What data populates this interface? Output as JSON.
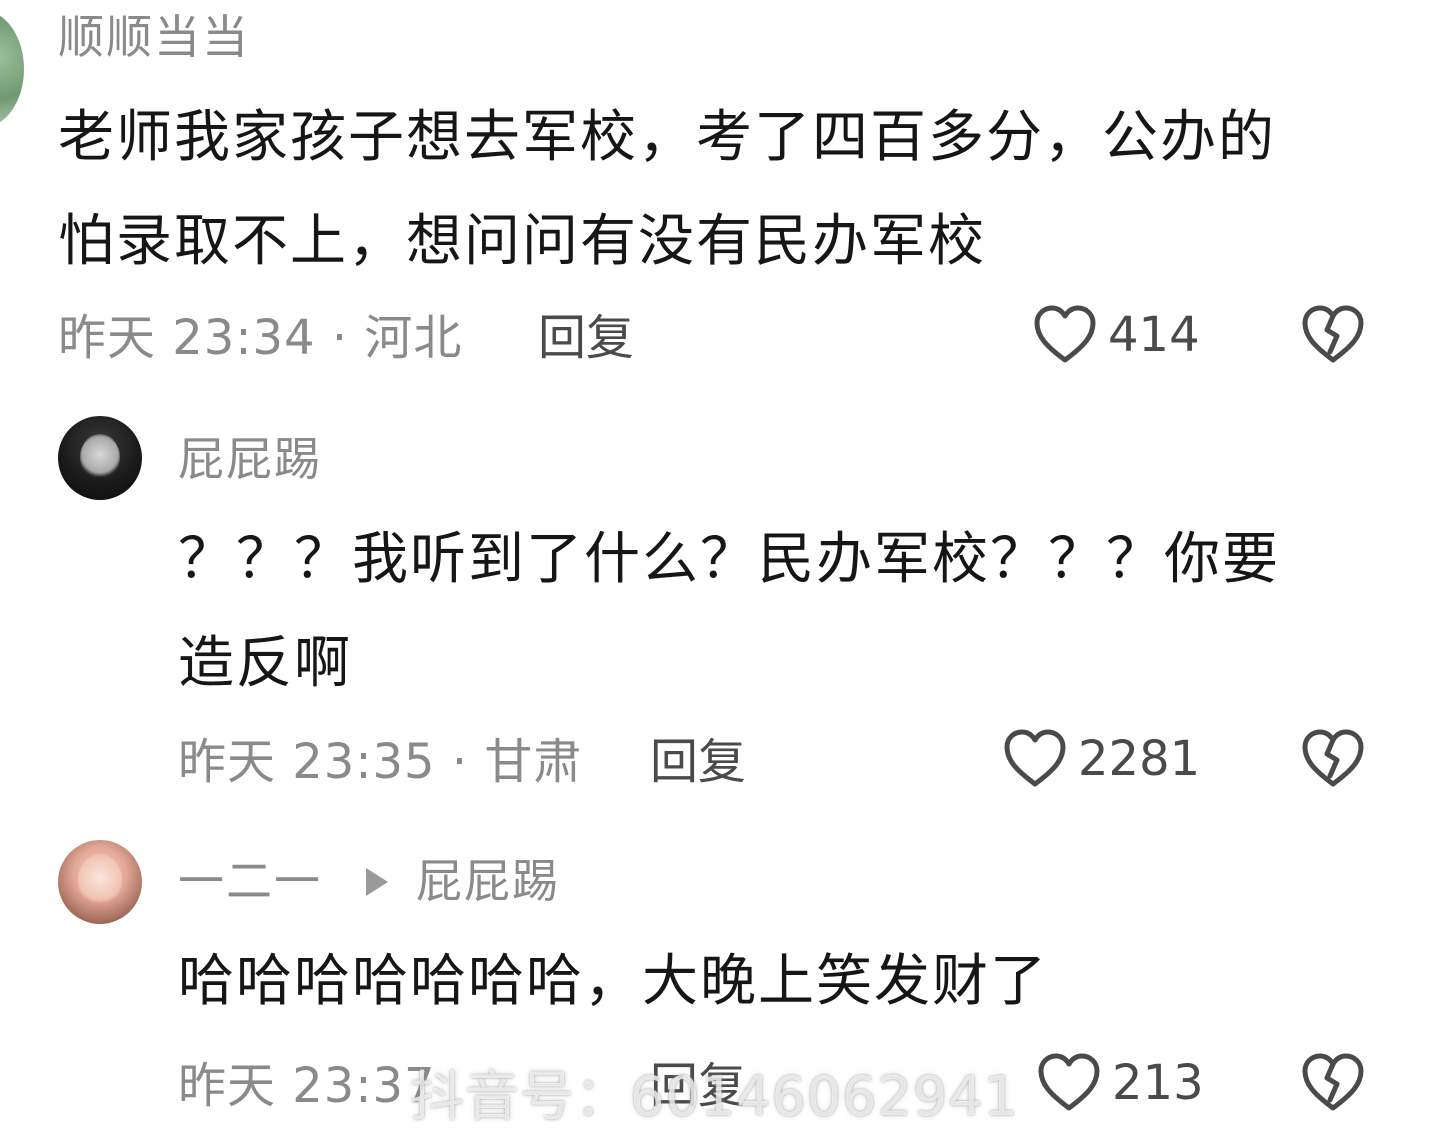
{
  "comments": [
    {
      "username": "顺顺当当",
      "text": "老师我家孩子想去军校，考了四百多分，公办的\n怕录取不上，想问问有没有民办军校",
      "time_location": "昨天 23:34 · 河北",
      "reply_label": "回复",
      "likes": "414"
    },
    {
      "username": "屁屁踢",
      "text": "？？？我听到了什么？民办军校？？？你要\n造反啊",
      "time_location": "昨天 23:35 · 甘肃",
      "reply_label": "回复",
      "likes": "2281"
    },
    {
      "username": "一二一",
      "reply_to": "屁屁踢",
      "text": "哈哈哈哈哈哈哈，大晚上笑发财了",
      "time_location": "昨天 23:37",
      "reply_label": "回复",
      "likes": "213"
    }
  ],
  "watermark": "抖音号：60146062941",
  "icons": {
    "like": "heart-outline-icon",
    "dislike": "broken-heart-icon",
    "reply_arrow": "play-arrow-icon"
  },
  "colors": {
    "primary_text": "#161616",
    "secondary_text": "#8a8a8a",
    "icon": "#4a4a4a"
  }
}
